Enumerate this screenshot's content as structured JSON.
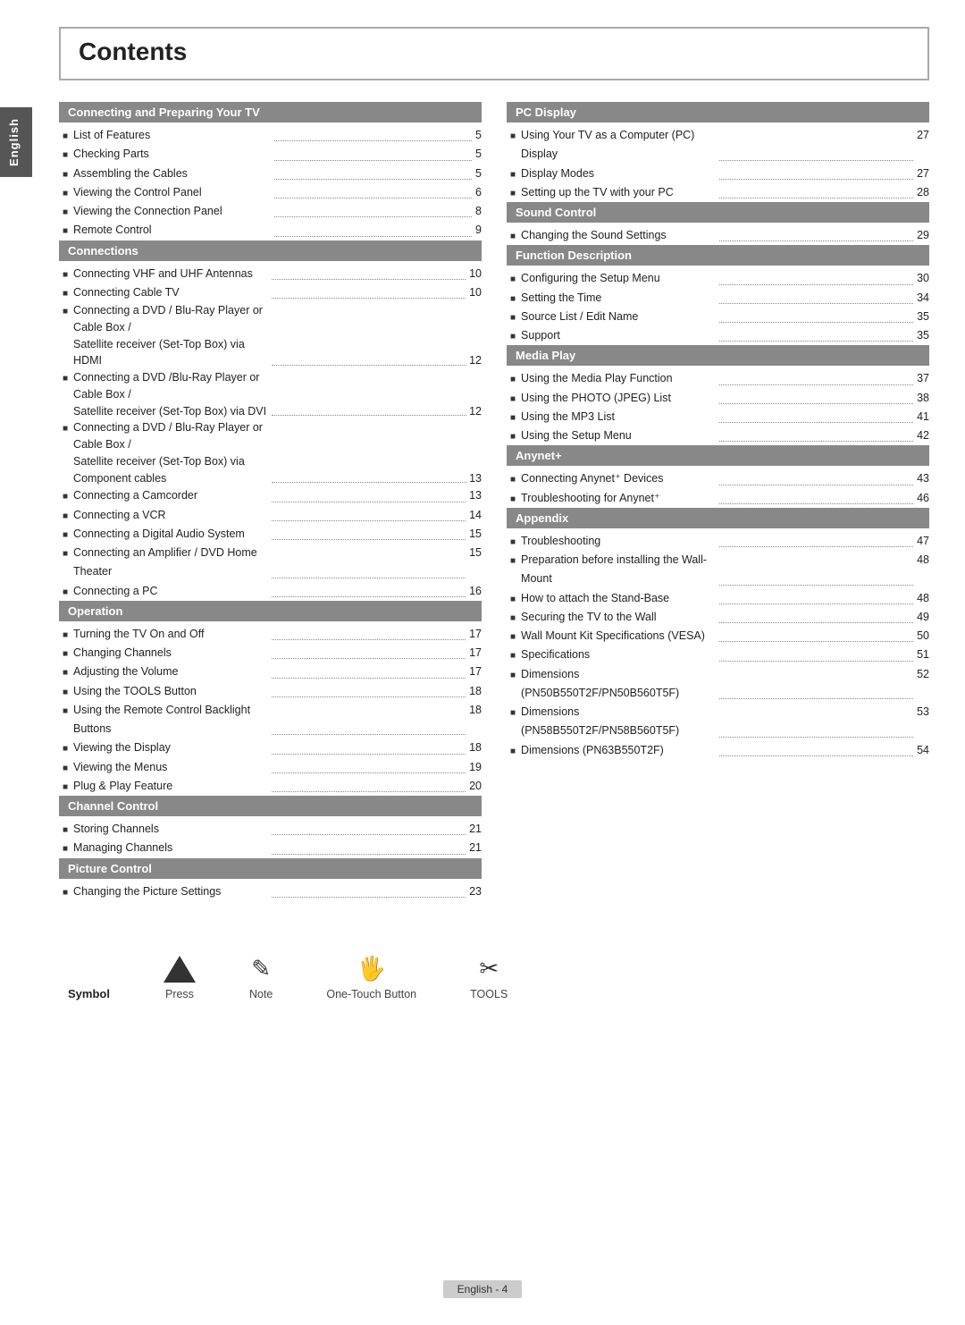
{
  "sidebar": {
    "label": "English"
  },
  "title": "Contents",
  "left_sections": [
    {
      "header": "Connecting and Preparing Your TV",
      "items": [
        {
          "label": "List of Features",
          "page": "5"
        },
        {
          "label": "Checking Parts",
          "page": "5"
        },
        {
          "label": "Assembling the Cables",
          "page": "5"
        },
        {
          "label": "Viewing the Control Panel",
          "page": "6"
        },
        {
          "label": "Viewing the Connection Panel",
          "page": "8"
        },
        {
          "label": "Remote Control",
          "page": "9"
        }
      ]
    },
    {
      "header": "Connections",
      "items": [
        {
          "label": "Connecting VHF and UHF Antennas",
          "page": "10"
        },
        {
          "label": "Connecting Cable TV",
          "page": "10"
        },
        {
          "label": "Connecting a DVD / Blu-Ray Player or Cable Box /\nSatellite receiver (Set-Top Box) via HDMI",
          "page": "12",
          "multiline": true
        },
        {
          "label": "Connecting a DVD /Blu-Ray Player or Cable Box /\nSatellite receiver (Set-Top Box) via DVI",
          "page": "12",
          "multiline": true
        },
        {
          "label": "Connecting a DVD / Blu-Ray Player or Cable Box /\nSatellite receiver (Set-Top Box) via Component cables",
          "page": "13",
          "multiline": true
        },
        {
          "label": "Connecting a Camcorder",
          "page": "13"
        },
        {
          "label": "Connecting a VCR",
          "page": "14"
        },
        {
          "label": "Connecting a Digital Audio System",
          "page": "15"
        },
        {
          "label": "Connecting an Amplifier / DVD Home Theater",
          "page": "15"
        },
        {
          "label": "Connecting a PC",
          "page": "16"
        }
      ]
    },
    {
      "header": "Operation",
      "items": [
        {
          "label": "Turning the TV On and Off",
          "page": "17"
        },
        {
          "label": "Changing Channels",
          "page": "17"
        },
        {
          "label": "Adjusting the Volume",
          "page": "17"
        },
        {
          "label": "Using the TOOLS Button",
          "page": "18"
        },
        {
          "label": "Using the Remote Control Backlight Buttons",
          "page": "18"
        },
        {
          "label": "Viewing the Display",
          "page": "18"
        },
        {
          "label": "Viewing the Menus",
          "page": "19"
        },
        {
          "label": "Plug & Play Feature",
          "page": "20"
        }
      ]
    },
    {
      "header": "Channel Control",
      "items": [
        {
          "label": "Storing Channels",
          "page": "21"
        },
        {
          "label": "Managing Channels",
          "page": "21"
        }
      ]
    },
    {
      "header": "Picture Control",
      "items": [
        {
          "label": "Changing the Picture Settings",
          "page": "23"
        }
      ]
    }
  ],
  "right_sections": [
    {
      "header": "PC Display",
      "items": [
        {
          "label": "Using Your TV as a Computer (PC) Display",
          "page": "27"
        },
        {
          "label": "Display Modes",
          "page": "27"
        },
        {
          "label": "Setting up the TV with your PC",
          "page": "28"
        }
      ]
    },
    {
      "header": "Sound Control",
      "items": [
        {
          "label": "Changing the Sound Settings",
          "page": "29"
        }
      ]
    },
    {
      "header": "Function Description",
      "items": [
        {
          "label": "Configuring the Setup Menu",
          "page": "30"
        },
        {
          "label": "Setting the Time",
          "page": "34"
        },
        {
          "label": "Source List / Edit Name",
          "page": "35"
        },
        {
          "label": "Support",
          "page": "35"
        }
      ]
    },
    {
      "header": "Media Play",
      "items": [
        {
          "label": "Using the Media Play Function",
          "page": "37"
        },
        {
          "label": "Using the PHOTO (JPEG) List",
          "page": "38"
        },
        {
          "label": "Using the MP3 List",
          "page": "41"
        },
        {
          "label": "Using the Setup Menu",
          "page": "42"
        }
      ]
    },
    {
      "header": "Anynet+",
      "items": [
        {
          "label": "Connecting Anynet⁺ Devices",
          "page": "43"
        },
        {
          "label": "Troubleshooting for Anynet⁺",
          "page": "46"
        }
      ]
    },
    {
      "header": "Appendix",
      "items": [
        {
          "label": "Troubleshooting",
          "page": "47"
        },
        {
          "label": "Preparation before installing the Wall-Mount",
          "page": "48"
        },
        {
          "label": "How to attach the Stand-Base",
          "page": "48"
        },
        {
          "label": "Securing the TV to the Wall",
          "page": "49"
        },
        {
          "label": "Wall Mount Kit Specifications (VESA)",
          "page": "50"
        },
        {
          "label": "Specifications",
          "page": "51"
        },
        {
          "label": "Dimensions (PN50B550T2F/PN50B560T5F)",
          "page": "52"
        },
        {
          "label": "Dimensions (PN58B550T2F/PN58B560T5F)",
          "page": "53"
        },
        {
          "label": "Dimensions (PN63B550T2F)",
          "page": "54"
        }
      ]
    }
  ],
  "symbols": {
    "label": "Symbol",
    "items": [
      {
        "name": "Press",
        "icon_type": "press"
      },
      {
        "name": "Note",
        "icon_type": "note"
      },
      {
        "name": "One-Touch Button",
        "icon_type": "onetouch"
      },
      {
        "name": "TOOLS",
        "icon_type": "tools"
      }
    ]
  },
  "footer": {
    "text": "English - 4"
  }
}
